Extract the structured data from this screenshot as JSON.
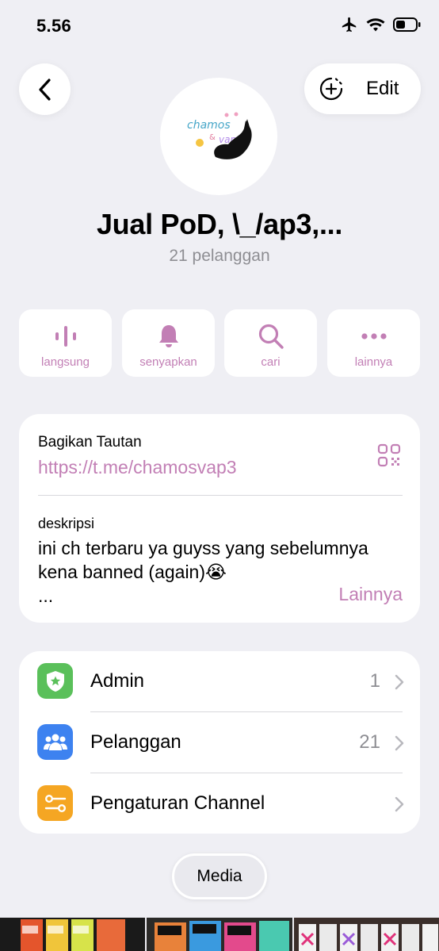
{
  "status_bar": {
    "time": "5.56"
  },
  "header": {
    "edit_label": "Edit"
  },
  "channel": {
    "title": "Jual PoD, \\_/ap3,...",
    "subtitle": "21 pelanggan",
    "avatar_text_1": "chamos",
    "avatar_text_2": "& vape"
  },
  "actions": [
    {
      "label": "langsung",
      "icon": "waveform-icon"
    },
    {
      "label": "senyapkan",
      "icon": "bell-icon"
    },
    {
      "label": "cari",
      "icon": "search-icon"
    },
    {
      "label": "lainnya",
      "icon": "more-icon"
    }
  ],
  "info": {
    "share_label": "Bagikan Tautan",
    "share_link": "https://t.me/chamosvap3",
    "desc_label": "deskripsi",
    "desc_line1": "ini ch terbaru ya guyss yang sebelumnya",
    "desc_line2": "kena banned (again)😭",
    "desc_line3": "...",
    "more_label": "Lainnya"
  },
  "settings": [
    {
      "label": "Admin",
      "count": "1",
      "icon": "admin-shield-icon",
      "color": "#5ac05a"
    },
    {
      "label": "Pelanggan",
      "count": "21",
      "icon": "people-icon",
      "color": "#3d82f0"
    },
    {
      "label": "Pengaturan Channel",
      "count": "",
      "icon": "settings-sliders-icon",
      "color": "#f5a623"
    }
  ],
  "media": {
    "label": "Media"
  },
  "colors": {
    "accent": "#c27fb5",
    "background": "#efeff4"
  }
}
